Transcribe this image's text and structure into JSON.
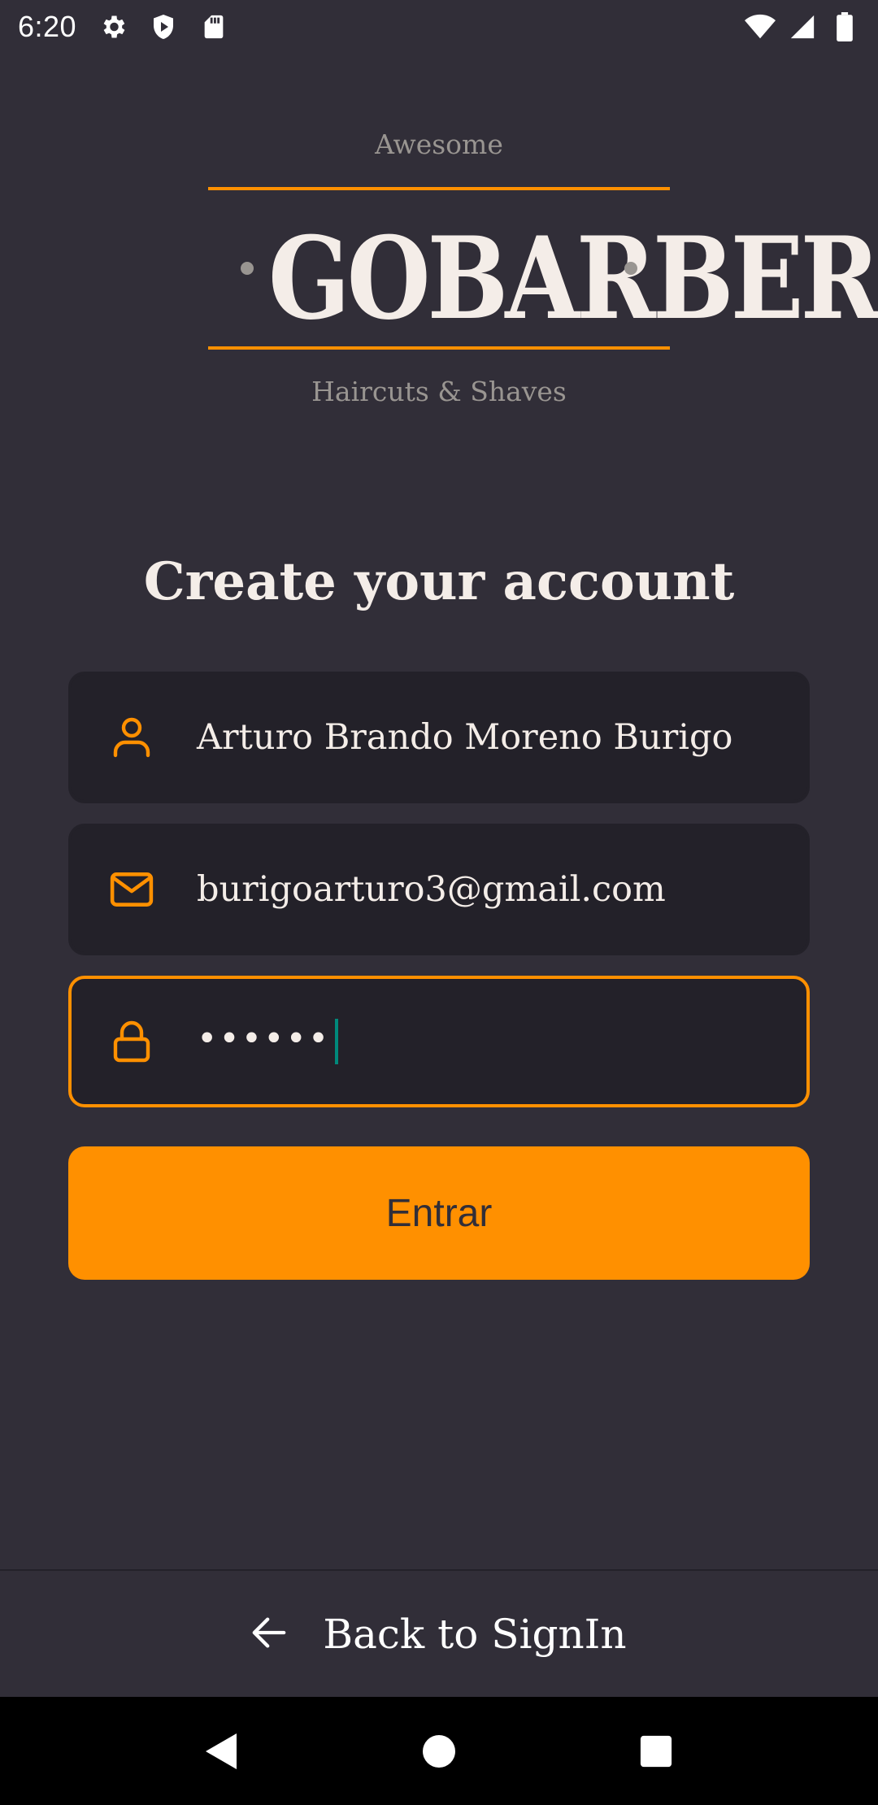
{
  "status_bar": {
    "time": "6:20",
    "left_icons": [
      "settings-icon",
      "shield-play-icon",
      "sd-card-icon"
    ],
    "right_icons": [
      "wifi-icon",
      "signal-icon",
      "battery-icon"
    ]
  },
  "logo": {
    "tagline_top": "Awesome",
    "wordmark": "GOBARBER",
    "tagline_bottom": "Haircuts & Shaves"
  },
  "page": {
    "title": "Create your account"
  },
  "form": {
    "name": {
      "icon": "user-icon",
      "value": "Arturo Brando Moreno Burigo"
    },
    "email": {
      "icon": "mail-icon",
      "value": "burigoarturo3@gmail.com"
    },
    "password": {
      "icon": "lock-icon",
      "value": "••••••",
      "focused": true
    },
    "submit_label": "Entrar"
  },
  "footer": {
    "back_icon": "arrow-left-icon",
    "back_label": "Back to SignIn"
  },
  "nav_bar": {
    "buttons": [
      "back-triangle-icon",
      "home-circle-icon",
      "recents-square-icon"
    ]
  },
  "colors": {
    "background": "#312e38",
    "input_background": "#232129",
    "accent": "#ff9000",
    "text": "#f4ede8",
    "muted": "#999591",
    "cursor": "#00897b"
  }
}
